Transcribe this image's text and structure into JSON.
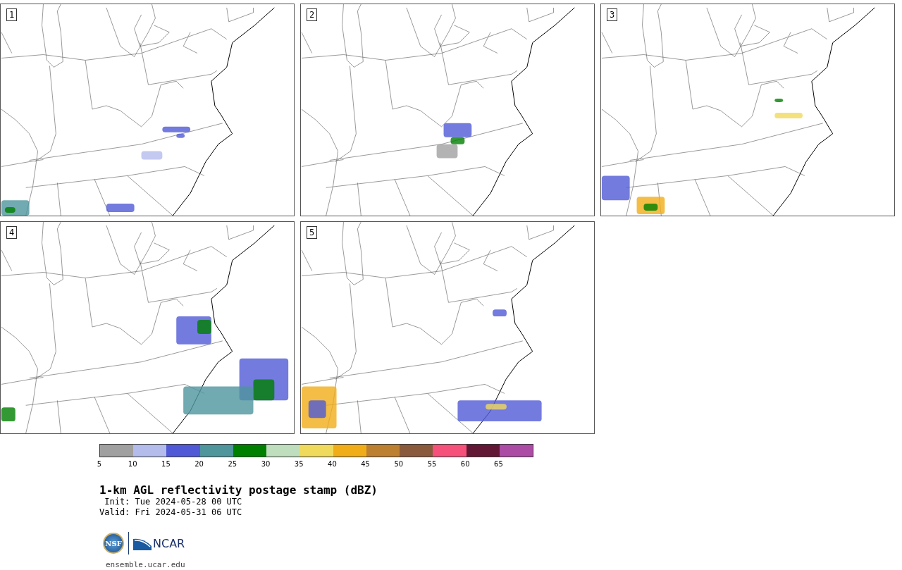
{
  "panels": [
    {
      "label": "1"
    },
    {
      "label": "2"
    },
    {
      "label": "3"
    },
    {
      "label": "4"
    },
    {
      "label": "5"
    }
  ],
  "colorbar": {
    "segments": [
      {
        "color": "#a0a0a0"
      },
      {
        "color": "#b4bcec"
      },
      {
        "color": "#505ad6"
      },
      {
        "color": "#4e959c"
      },
      {
        "color": "#008000"
      },
      {
        "color": "#bfdebd"
      },
      {
        "color": "#f0da5c"
      },
      {
        "color": "#f0ad18"
      },
      {
        "color": "#bc8030"
      },
      {
        "color": "#8a5a3c"
      },
      {
        "color": "#f5517b"
      },
      {
        "color": "#621835"
      },
      {
        "color": "#ac4ca4"
      }
    ],
    "ticks": [
      "5",
      "10",
      "15",
      "20",
      "25",
      "30",
      "35",
      "40",
      "45",
      "50",
      "55",
      "60",
      "65"
    ]
  },
  "title": "1-km AGL reflectivity postage stamp (dBZ)",
  "init": " Init: Tue 2024-05-28 00 UTC",
  "valid": "Valid: Fri 2024-05-31 06 UTC",
  "logos": {
    "nsf": "NSF",
    "ncar": "NCAR"
  },
  "url": "ensemble.ucar.edu"
}
